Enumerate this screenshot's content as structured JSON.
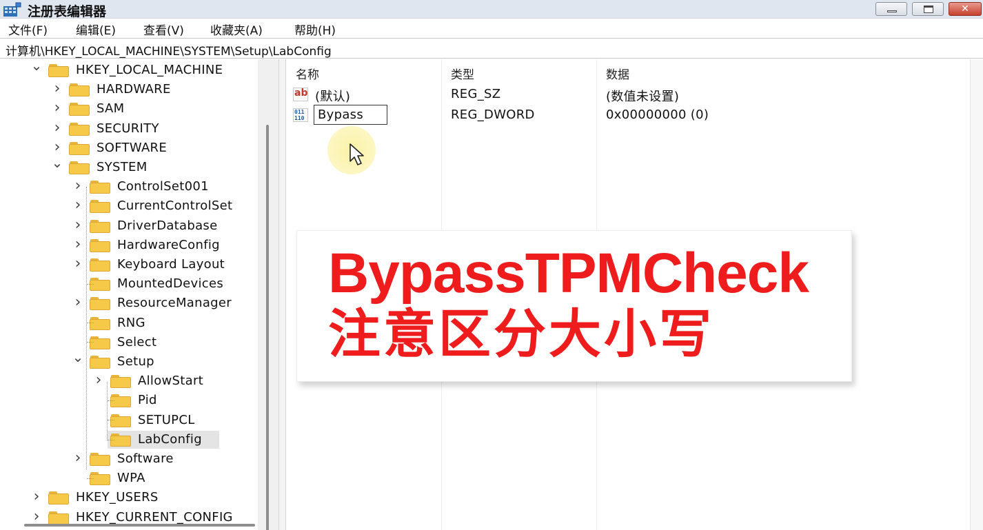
{
  "window": {
    "title": "注册表编辑器",
    "icon": "registry-editor-icon",
    "close_color": "#c7412f"
  },
  "menu": {
    "items": [
      "文件(F)",
      "编辑(E)",
      "查看(V)",
      "收藏夹(A)",
      "帮助(H)"
    ]
  },
  "address": {
    "path": "计算机\\HKEY_LOCAL_MACHINE\\SYSTEM\\Setup\\LabConfig"
  },
  "tree": {
    "nodes": [
      {
        "label": "HKEY_LOCAL_MACHINE",
        "expander": "expanded"
      },
      {
        "label": "HARDWARE",
        "expander": "collapsed"
      },
      {
        "label": "SAM",
        "expander": "collapsed"
      },
      {
        "label": "SECURITY",
        "expander": "collapsed"
      },
      {
        "label": "SOFTWARE",
        "expander": "collapsed"
      },
      {
        "label": "SYSTEM",
        "expander": "expanded"
      },
      {
        "label": "ControlSet001",
        "expander": "collapsed"
      },
      {
        "label": "CurrentControlSet",
        "expander": "collapsed"
      },
      {
        "label": "DriverDatabase",
        "expander": "collapsed"
      },
      {
        "label": "HardwareConfig",
        "expander": "collapsed"
      },
      {
        "label": "Keyboard Layout",
        "expander": "collapsed"
      },
      {
        "label": "MountedDevices",
        "expander": "none"
      },
      {
        "label": "ResourceManager",
        "expander": "collapsed"
      },
      {
        "label": "RNG",
        "expander": "none"
      },
      {
        "label": "Select",
        "expander": "none"
      },
      {
        "label": "Setup",
        "expander": "expanded"
      },
      {
        "label": "AllowStart",
        "expander": "collapsed"
      },
      {
        "label": "Pid",
        "expander": "none"
      },
      {
        "label": "SETUPCL",
        "expander": "none"
      },
      {
        "label": "LabConfig",
        "expander": "none",
        "selected": true
      },
      {
        "label": "Software",
        "expander": "collapsed"
      },
      {
        "label": "WPA",
        "expander": "none"
      },
      {
        "label": "HKEY_USERS",
        "expander": "collapsed"
      },
      {
        "label": "HKEY_CURRENT_CONFIG",
        "expander": "collapsed"
      }
    ]
  },
  "list": {
    "columns": [
      "名称",
      "类型",
      "数据"
    ],
    "rows": [
      {
        "icon": "string-value-icon",
        "icon_text": "ab",
        "name": "(默认)",
        "type": "REG_SZ",
        "data": "(数值未设置)"
      },
      {
        "icon": "binary-value-icon",
        "icon_text": "011\n110",
        "name": "Bypass",
        "type": "REG_DWORD",
        "data": "0x00000000 (0)",
        "renaming": true
      }
    ]
  },
  "overlay": {
    "line1": "BypassTPMCheck",
    "line2": "注意区分大小写",
    "color": "#ee1c1c"
  }
}
